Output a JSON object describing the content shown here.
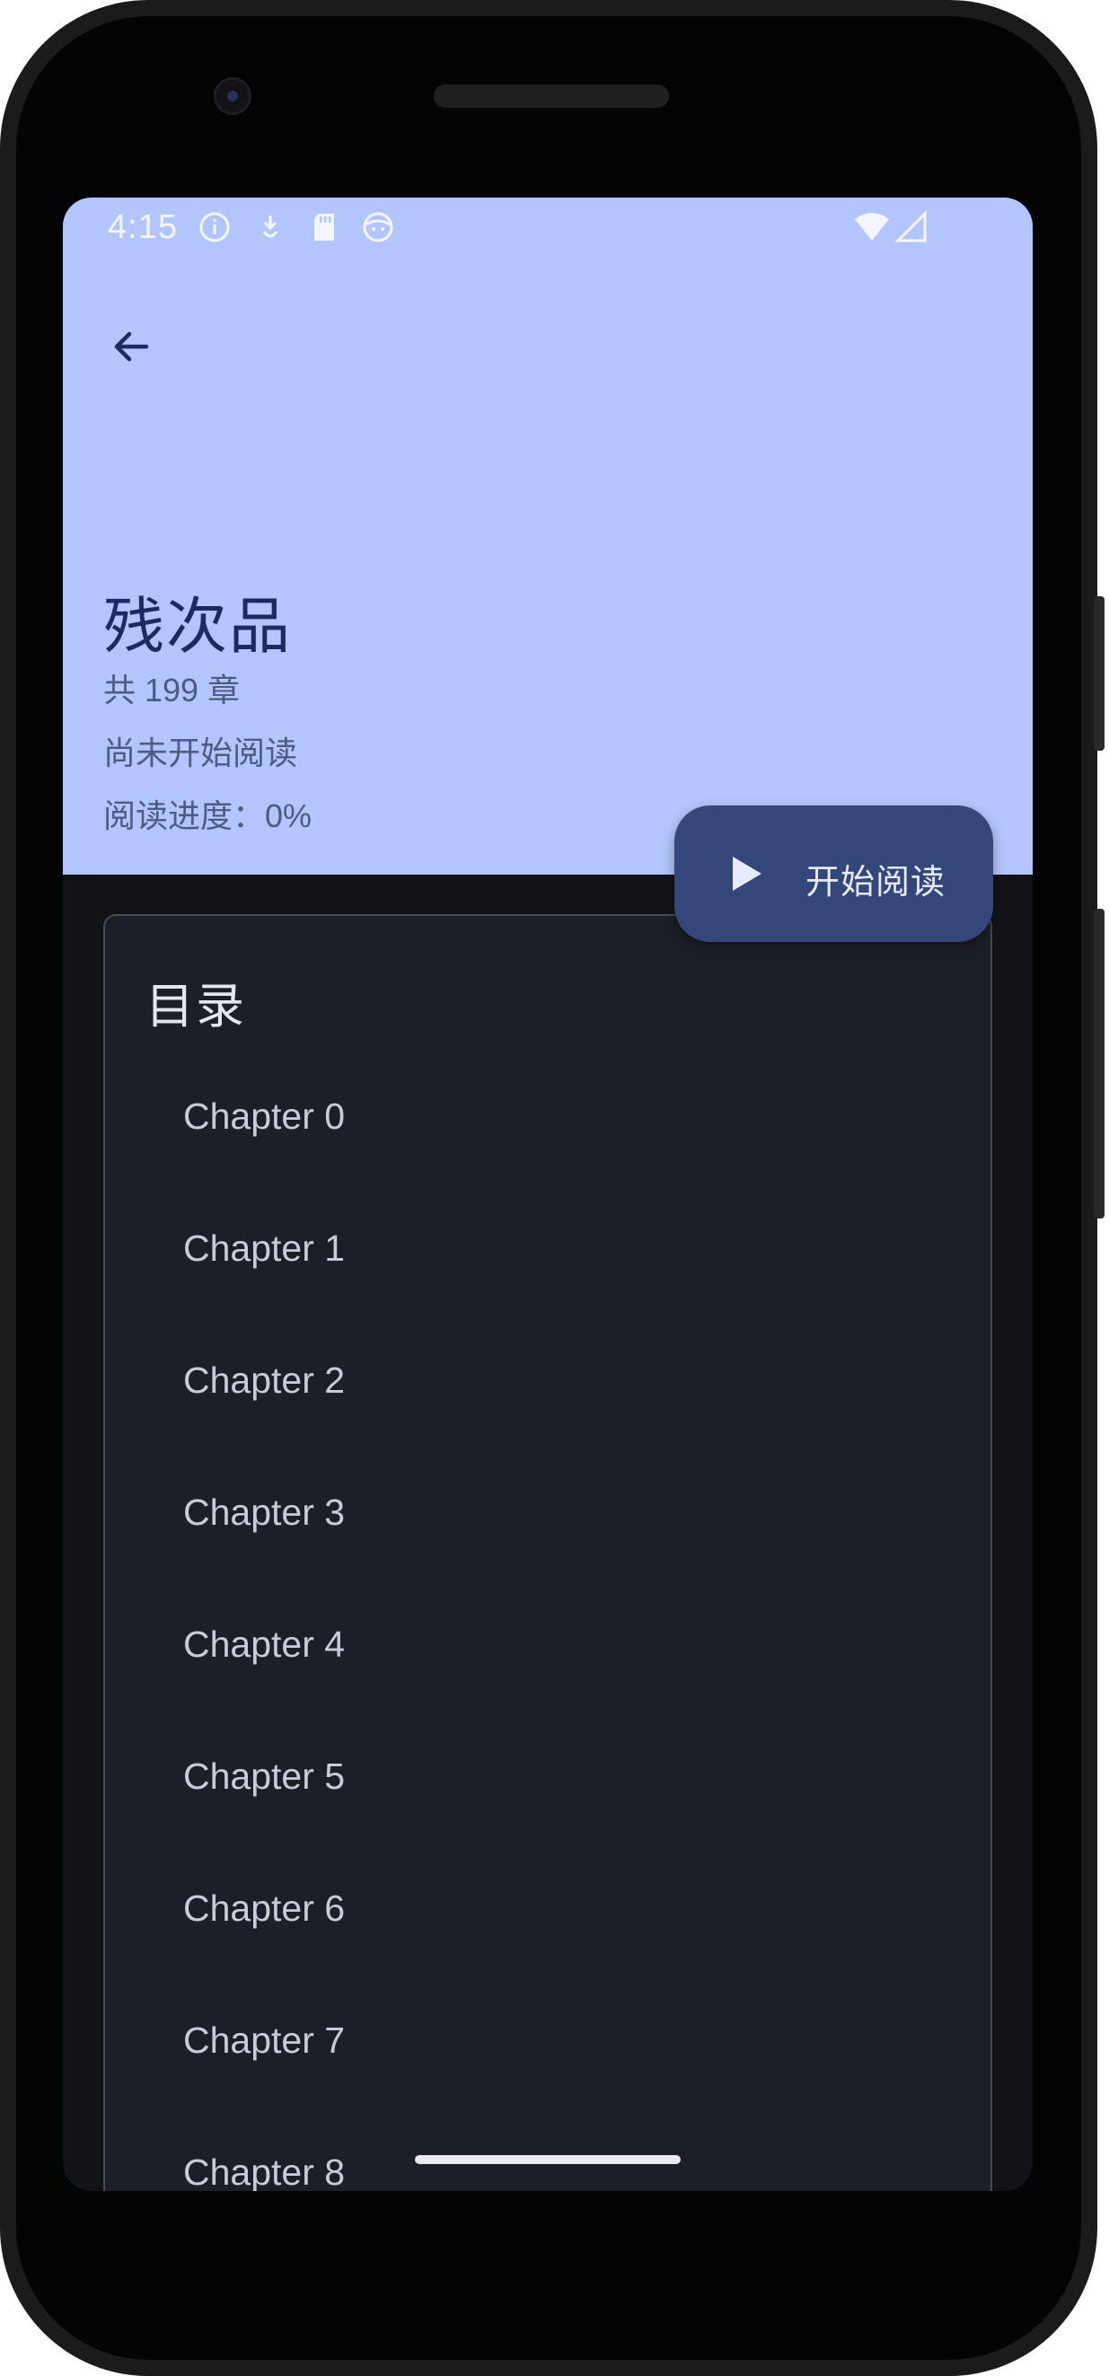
{
  "status_bar": {
    "time": "4:15",
    "icons": [
      "info-icon",
      "download-icon",
      "sd-card-icon",
      "face-icon",
      "wifi-icon",
      "signal-icon"
    ]
  },
  "header": {
    "back_icon": "arrow-left-icon",
    "book_title": "残次品",
    "chapter_count": "共 199 章",
    "reading_status": "尚未开始阅读",
    "reading_progress": "阅读进度：0%"
  },
  "fab": {
    "icon": "play-icon",
    "label": "开始阅读"
  },
  "toc": {
    "title": "目录",
    "chapters": [
      "Chapter 0",
      "Chapter 1",
      "Chapter 2",
      "Chapter 3",
      "Chapter 4",
      "Chapter 5",
      "Chapter 6",
      "Chapter 7",
      "Chapter 8"
    ]
  },
  "colors": {
    "header_bg": "#b3c5fd",
    "title_text": "#1a2b63",
    "fab_bg": "#33477b",
    "card_bg": "#1d1f27",
    "screen_bg": "#121318"
  }
}
